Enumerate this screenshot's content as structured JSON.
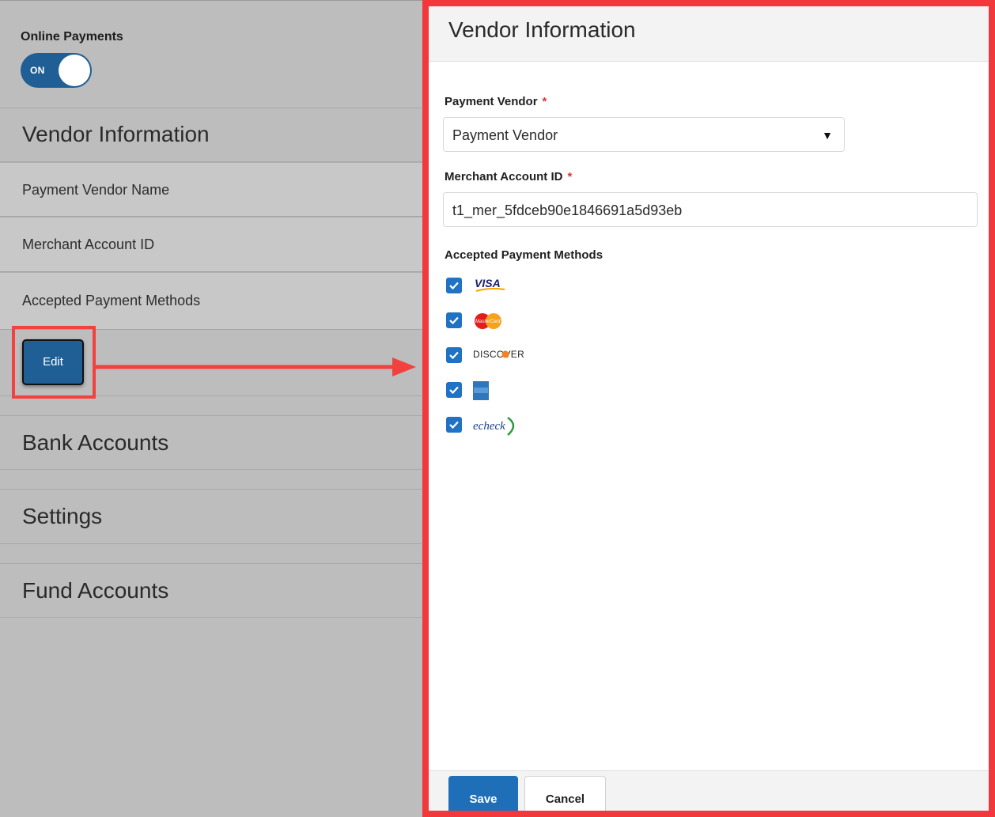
{
  "left_panel": {
    "online_payments": {
      "title": "Online Payments",
      "toggle_label": "ON"
    },
    "vendor_section": {
      "heading": "Vendor Information",
      "rows": [
        "Payment Vendor Name",
        "Merchant Account ID",
        "Accepted Payment Methods"
      ],
      "edit_label": "Edit"
    },
    "sections": [
      "Bank Accounts",
      "Settings",
      "Fund Accounts"
    ]
  },
  "right_panel": {
    "heading": "Vendor Information",
    "payment_vendor": {
      "label": "Payment Vendor",
      "required_mark": "*",
      "value": "Payment Vendor"
    },
    "merchant_account": {
      "label": "Merchant Account ID",
      "required_mark": "*",
      "value": "t1_mer_5fdceb90e1846691a5d93eb"
    },
    "methods": {
      "label": "Accepted Payment Methods",
      "items": [
        {
          "name": "visa",
          "checked": true,
          "logo_text": "VISA"
        },
        {
          "name": "mastercard",
          "checked": true,
          "logo_text": "MasterCard"
        },
        {
          "name": "discover",
          "checked": true,
          "logo_text": "DISCOVER"
        },
        {
          "name": "american-express",
          "checked": true,
          "logo_text": "AMERICAN EXPRESS"
        },
        {
          "name": "echeck",
          "checked": true,
          "logo_text": "echeck"
        }
      ]
    },
    "footer": {
      "save_label": "Save",
      "cancel_label": "Cancel"
    }
  },
  "colors": {
    "primary": "#1f5f96",
    "highlight": "#f2383b",
    "checkbox": "#1f72c4"
  }
}
